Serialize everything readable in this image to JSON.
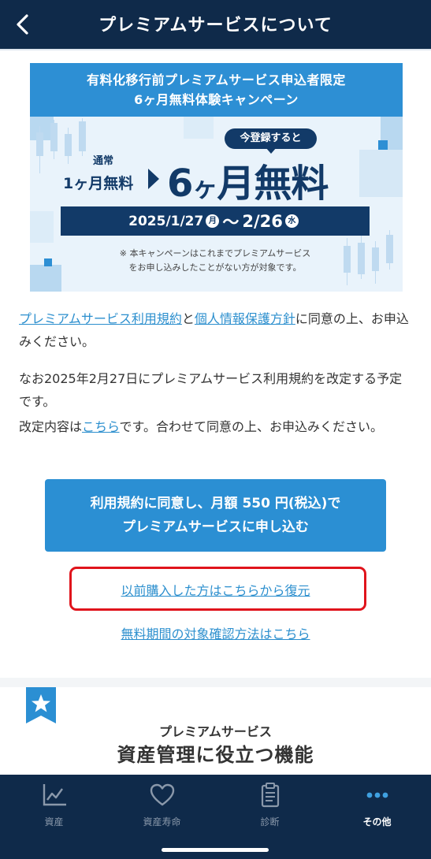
{
  "header": {
    "title": "プレミアムサービスについて",
    "back_icon": "chevron-left-icon"
  },
  "banner": {
    "headline_1": "有料化移行前プレミアムサービス申込者限定",
    "headline_2": "6ヶ月無料体験キャンペーン",
    "register_pill": "今登録すると",
    "normal_label": "通常",
    "normal_value": "1ヶ月無料",
    "big_number": "6",
    "big_ka": "ヶ",
    "big_suffix": "月無料",
    "date_start": "2025/1/27",
    "date_start_day": "月",
    "date_tilde": "〜",
    "date_end": "2/26",
    "date_end_day": "水",
    "note_line_1": "※ 本キャンペーンはこれまでプレミアムサービス",
    "note_line_2": "をお申し込みしたことがない方が対象です。"
  },
  "content": {
    "terms_link": "プレミアムサービス利用規約",
    "and_text": "と",
    "privacy_link": "個人情報保護方針",
    "agree_text": "に同意の上、お申込みください。",
    "revision_text_1": "なお2025年2月27日にプレミアムサービス利用規約を改定する予定です。",
    "revision_prefix": "改定内容は",
    "revision_link": "こちら",
    "revision_suffix": "です。合わせて同意の上、お申込みください。"
  },
  "apply_button": {
    "line_1": "利用規約に同意し、月額 550 円(税込)で",
    "line_2": "プレミアムサービスに申し込む"
  },
  "restore_link": "以前購入した方はこちらから復元",
  "confirm_link": "無料期間の対象確認方法はこちら",
  "premium_section": {
    "subtitle": "プレミアムサービス",
    "title": "資産管理に役立つ機能",
    "badge_icon": "star-icon"
  },
  "tabbar": {
    "items": [
      {
        "label": "資産",
        "icon": "chart-icon",
        "active": false
      },
      {
        "label": "資産寿命",
        "icon": "heart-icon",
        "active": false
      },
      {
        "label": "診断",
        "icon": "clipboard-icon",
        "active": false
      },
      {
        "label": "その他",
        "icon": "more-icon",
        "active": true
      }
    ]
  },
  "colors": {
    "header_bg": "#0f2a4a",
    "accent": "#2b8fd3",
    "link": "#2c8fce",
    "highlight_border": "#e0141c",
    "banner_navy": "#123a68"
  }
}
